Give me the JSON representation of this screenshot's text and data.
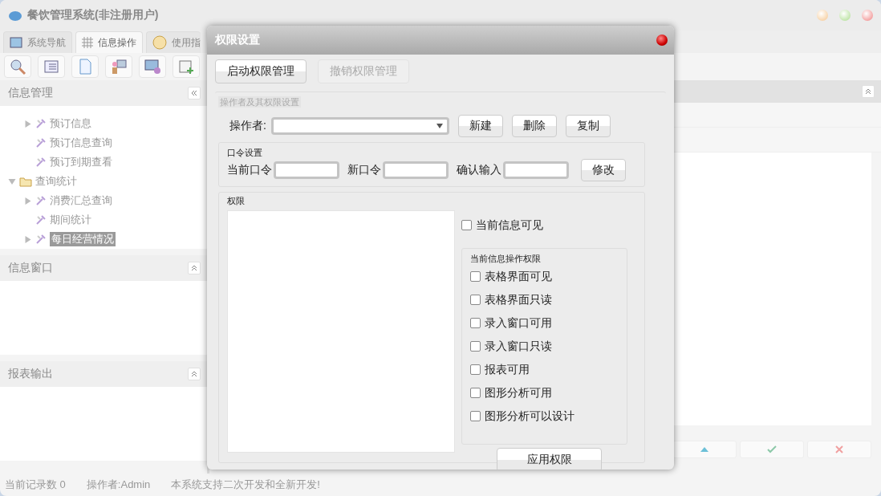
{
  "window": {
    "title": "餐饮管理系统(非注册用户)"
  },
  "tabs": [
    {
      "label": "系统导航",
      "selected": false,
      "kind": "monitor"
    },
    {
      "label": "信息操作",
      "selected": true,
      "kind": "grid"
    },
    {
      "label": "使用指",
      "selected": false,
      "kind": "clock"
    }
  ],
  "panels": [
    {
      "title": "信息管理",
      "kind": "tree"
    },
    {
      "title": "信息窗口",
      "kind": "blank"
    },
    {
      "title": "报表输出",
      "kind": "blank"
    }
  ],
  "tree": [
    {
      "children": [
        {
          "label": "预订信息",
          "kind": "item",
          "expanded": false,
          "selected": false
        },
        {
          "label": "预订信息查询",
          "kind": "item",
          "selected": false
        },
        {
          "label": "预订到期查看",
          "kind": "item",
          "selected": false
        }
      ]
    },
    {
      "label": "查询统计",
      "kind": "folder",
      "expanded": true,
      "selected": false,
      "children": [
        {
          "label": "消费汇总查询",
          "kind": "item",
          "expanded": false,
          "selected": false
        },
        {
          "label": "期间统计",
          "kind": "item",
          "selected": false
        },
        {
          "label": "每日经营情况",
          "kind": "item",
          "expanded": false,
          "selected": true
        }
      ]
    }
  ],
  "status_bar": [
    "当前记录数 0",
    "操作者:Admin",
    "本系统支持二次开发和全新开发!"
  ],
  "dialog": {
    "title": "权限设置",
    "buttons": [
      {
        "label": "启动权限管理",
        "disabled": false
      },
      {
        "label": "撤销权限管理",
        "disabled": true
      }
    ],
    "group_title": "操作者及其权限设置",
    "operator_label": "操作者:",
    "operator_buttons": [
      "新建",
      "删除",
      "复制"
    ],
    "password": {
      "title": "口令设置",
      "fields": [
        "当前口令",
        "新口令",
        "确认输入"
      ],
      "button": "修改"
    },
    "permissions": {
      "title": "权限",
      "options": [
        {
          "label": "当前信息可见",
          "checked": false
        }
      ],
      "sub_group": {
        "title": "当前信息操作权限",
        "options": [
          {
            "label": "表格界面可见",
            "checked": false
          },
          {
            "label": "表格界面只读",
            "checked": false
          },
          {
            "label": "录入窗口可用",
            "checked": false
          },
          {
            "label": "录入窗口只读",
            "checked": false
          },
          {
            "label": "报表可用",
            "checked": false
          },
          {
            "label": "图形分析可用",
            "checked": false
          },
          {
            "label": "图形分析可以设计",
            "checked": false
          }
        ]
      },
      "apply_button": "应用权限"
    }
  }
}
